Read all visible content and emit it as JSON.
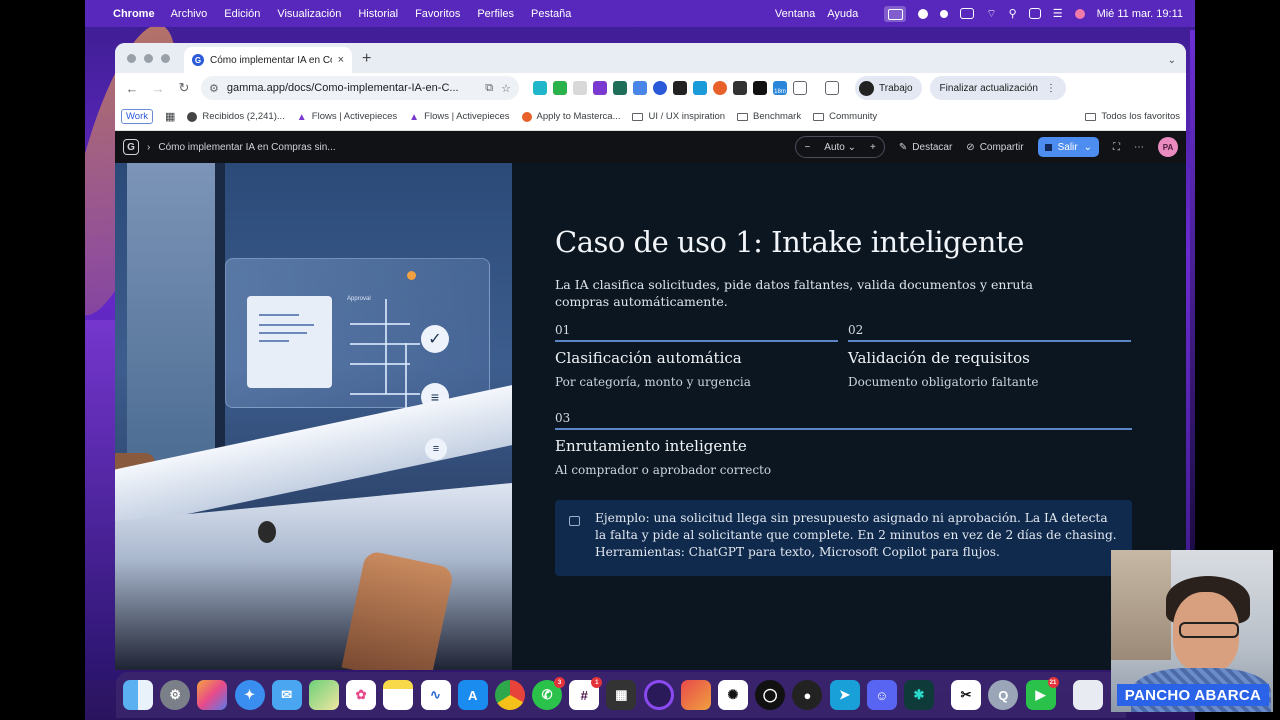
{
  "menubar": {
    "app": "Chrome",
    "items": [
      "Archivo",
      "Edición",
      "Visualización",
      "Historial",
      "Favoritos",
      "Perfiles",
      "Pestaña"
    ],
    "right_items": [
      "Ventana",
      "Ayuda"
    ],
    "datetime": "Mié 11 mar.  19:11"
  },
  "browser": {
    "tab_title": "Cómo implementar IA en Com",
    "tab_close": "×",
    "new_tab": "+",
    "url": "gamma.app/docs/Como-implementar-IA-en-C...",
    "profile_label": "Trabajo",
    "update_label": "Finalizar actualización",
    "badge_18m": "18m"
  },
  "bookmarks": [
    {
      "label": "Work"
    },
    {
      "label": "Recibidos (2,241)..."
    },
    {
      "label": "Flows | Activepieces"
    },
    {
      "label": "Flows | Activepieces"
    },
    {
      "label": "Apply to Masterca..."
    },
    {
      "label": "UI / UX inspiration"
    },
    {
      "label": "Benchmark"
    },
    {
      "label": "Community"
    }
  ],
  "bookmarks_right": "Todos los favoritos",
  "gamma": {
    "breadcrumb": "Cómo implementar IA en Compras sin...",
    "zoom_label": "Auto",
    "zoom_minus": "−",
    "zoom_plus": "+",
    "highlight_label": "Destacar",
    "share_label": "Compartir",
    "exit_label": "Salir",
    "avatar_initials": "PA"
  },
  "slide": {
    "title": "Caso de uso 1: Intake inteligente",
    "subtitle": "La IA clasifica solicitudes, pide datos faltantes, valida documentos y enruta compras automáticamente.",
    "items": [
      {
        "num": "01",
        "title": "Clasificación automática",
        "desc": "Por categoría, monto y urgencia"
      },
      {
        "num": "02",
        "title": "Validación de requisitos",
        "desc": "Documento obligatorio faltante"
      },
      {
        "num": "03",
        "title": "Enrutamiento inteligente",
        "desc": "Al comprador o aprobador correcto"
      }
    ],
    "callout": "Ejemplo: una solicitud llega sin presupuesto asignado ni aprobación. La IA detecta la falta y pide al solicitante que complete. En 2 minutos en vez de 2 días de chasing. Herramientas: ChatGPT para texto, Microsoft Copilot para flujos.",
    "image_label": "Approval"
  },
  "dock": {
    "badges": {
      "whatsapp": "3",
      "slack": "1",
      "facetime": "21"
    }
  },
  "webcam": {
    "name": "PANCHO ABARCA"
  }
}
